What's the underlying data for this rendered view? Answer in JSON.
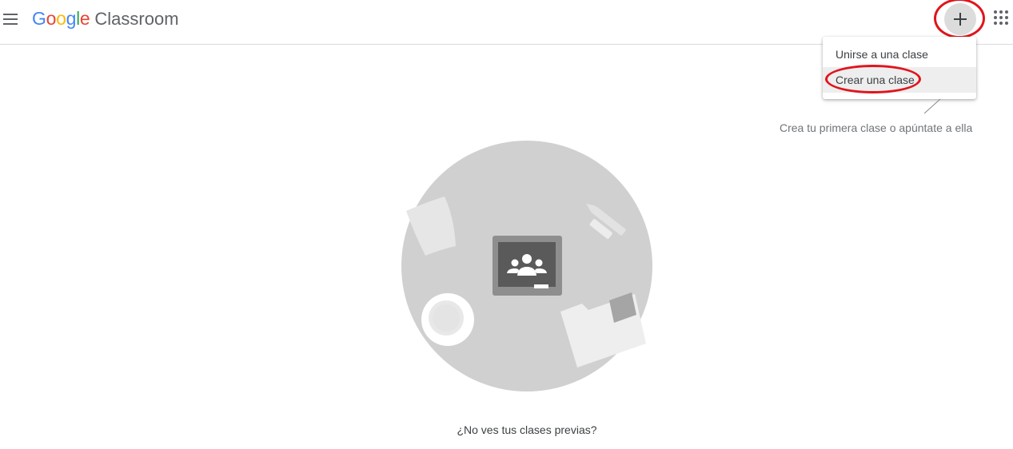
{
  "app": {
    "brand_google": "Google",
    "brand_product": "Classroom"
  },
  "header": {
    "menu_icon": "hamburger-menu-icon",
    "add_icon": "plus-icon",
    "apps_icon": "apps-grid-icon"
  },
  "dropdown": {
    "items": [
      {
        "label": "Unirse a una clase"
      },
      {
        "label": "Crear una clase",
        "highlighted": true
      }
    ]
  },
  "hint": {
    "text": "Crea tu primera clase o apúntate a ella"
  },
  "empty_state": {
    "illustration_icon": "classroom-empty-state-illustration",
    "link_text": "¿No ves tus clases previas?"
  },
  "colors": {
    "annotation_red": "#e0141d",
    "google_blue": "#4285f4",
    "google_red": "#ea4335",
    "google_yellow": "#fbbc05",
    "google_green": "#34a853",
    "circle_grey": "#d0d0d0",
    "board_dark": "#5a5a5a"
  }
}
